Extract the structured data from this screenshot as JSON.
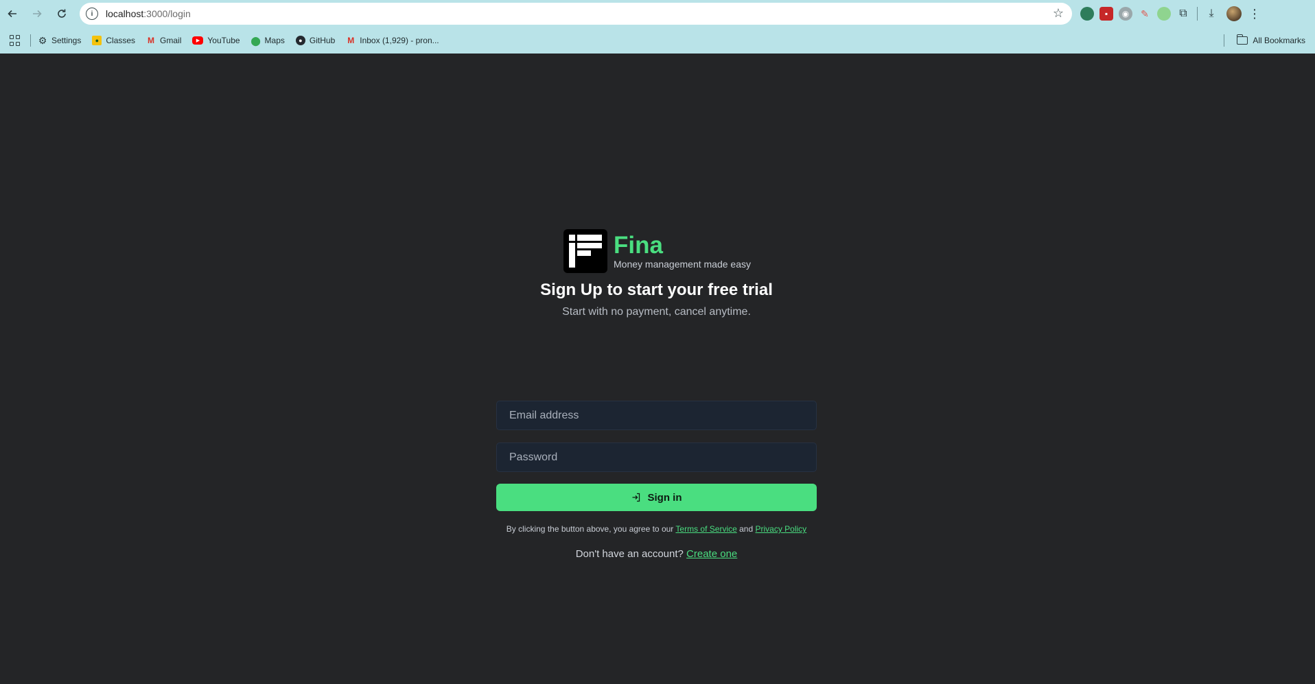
{
  "browser": {
    "url_host": "localhost",
    "url_path": ":3000/login",
    "bookmarks": [
      {
        "label": "Settings",
        "icon": "gear-icon"
      },
      {
        "label": "Classes",
        "icon": "classes-icon"
      },
      {
        "label": "Gmail",
        "icon": "gmail-icon"
      },
      {
        "label": "YouTube",
        "icon": "youtube-icon"
      },
      {
        "label": "Maps",
        "icon": "maps-icon"
      },
      {
        "label": "GitHub",
        "icon": "github-icon"
      },
      {
        "label": "Inbox (1,929) - pron...",
        "icon": "gmail-icon"
      }
    ],
    "all_bookmarks": "All Bookmarks"
  },
  "brand": {
    "name": "Fina",
    "tagline": "Money management made easy",
    "accent_color": "#4ade80"
  },
  "form": {
    "heading": "Sign Up to start your free trial",
    "subheading": "Start with no payment, cancel anytime.",
    "email_placeholder": "Email address",
    "password_placeholder": "Password",
    "submit_label": "Sign in",
    "legal_prefix": "By clicking the button above, you agree to our",
    "terms_link": "Terms of Service",
    "legal_and": "and",
    "privacy_link": "Privacy Policy",
    "signup_prompt": "Don't have an account?",
    "signup_link": "Create one"
  }
}
